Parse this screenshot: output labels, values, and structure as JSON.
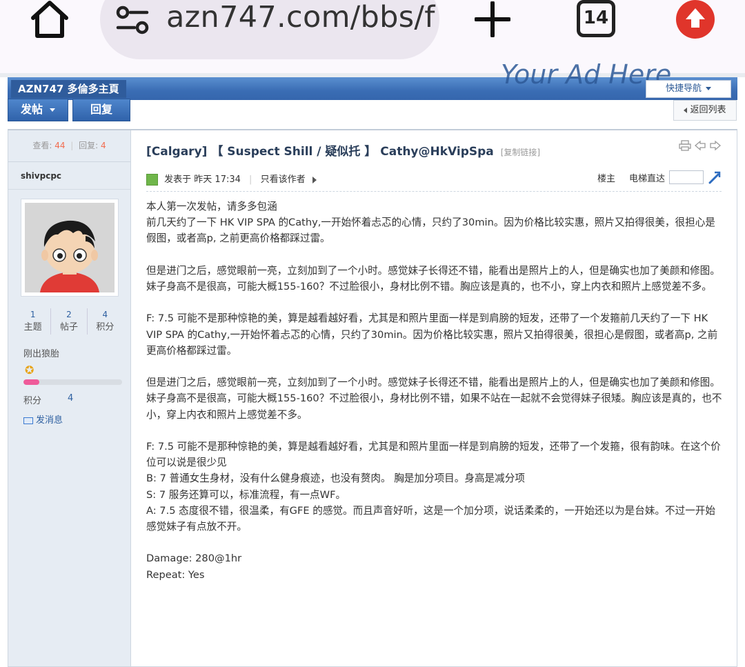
{
  "browser": {
    "url": "azn747.com/bbs/f",
    "tab_count": "14"
  },
  "header": {
    "site_title": "AZN747 多倫多主頁",
    "ad_text": "Your Ad Here",
    "quick_nav": "快捷导航",
    "post_button": "发帖",
    "reply_button": "回复",
    "back_button": "返回列表"
  },
  "sidebar": {
    "views_label": "查看:",
    "views": "44",
    "replies_label": "回复:",
    "replies": "4",
    "username": "shivpcpc",
    "stats": [
      {
        "num": "1",
        "label": "主题"
      },
      {
        "num": "2",
        "label": "帖子"
      },
      {
        "num": "4",
        "label": "积分"
      }
    ],
    "rank": "刚出狼胎",
    "progress_fraction": 0.16,
    "points_label": "积分",
    "points": "4",
    "send_message": "发消息"
  },
  "post": {
    "title": "[Calgary] 【 Suspect Shill / 疑似托 】 Cathy@HkVipSpa",
    "copy_link": "[复制链接]",
    "posted_prefix": "发表于",
    "posted_time": "昨天 17:34",
    "only_author": "只看该作者",
    "floor": "楼主",
    "jump_label": "电梯直达",
    "lines": [
      "本人第一次发帖，请多多包涵",
      "前几天约了一下 HK VIP SPA 的Cathy,一开始怀着忐忑的心情，只约了30min。因为价格比较实惠，照片又拍得很美，很担心是假图，或者高p, 之前更高价格都踩过雷。",
      "",
      "但是进门之后，感觉眼前一亮，立刻加到了一个小时。感觉妹子长得还不错，能看出是照片上的人，但是确实也加了美颜和修图。",
      "妹子身高不是很高，可能大概155-160？不过脸很小，身材比例不错。胸应该是真的，也不小，穿上内衣和照片上感觉差不多。",
      "",
      "F: 7.5 可能不是那种惊艳的美，算是越看越好看，尤其是和照片里面一样是到肩膀的短发，还带了一个发箍前几天约了一下 HK VIP SPA 的Cathy,一开始怀着忐忑的心情，只约了30min。因为价格比较实惠，照片又拍得很美，很担心是假图，或者高p, 之前更高价格都踩过雷。",
      "",
      "但是进门之后，感觉眼前一亮，立刻加到了一个小时。感觉妹子长得还不错，能看出是照片上的人，但是确实也加了美颜和修图。",
      "妹子身高不是很高，可能大概155-160？不过脸很小，身材比例不错，如果不站在一起就不会觉得妹子很矮。胸应该是真的，也不小，穿上内衣和照片上感觉差不多。",
      "",
      "F: 7.5 可能不是那种惊艳的美，算是越看越好看，尤其是和照片里面一样是到肩膀的短发，还带了一个发箍，很有韵味。在这个价位可以说是很少见",
      "B: 7 普通女生身材，没有什么健身痕迹，也没有赘肉。 胸是加分项目。身高是减分项",
      "S: 7 服务还算可以，标准流程，有一点WF。",
      "A: 7.5 态度很不错，很温柔，有GFE 的感觉。而且声音好听，这是一个加分项，说话柔柔的，一开始还以为是台妹。不过一开始感觉妹子有点放不开。",
      "",
      "Damage: 280@1hr",
      "Repeat: Yes"
    ]
  }
}
